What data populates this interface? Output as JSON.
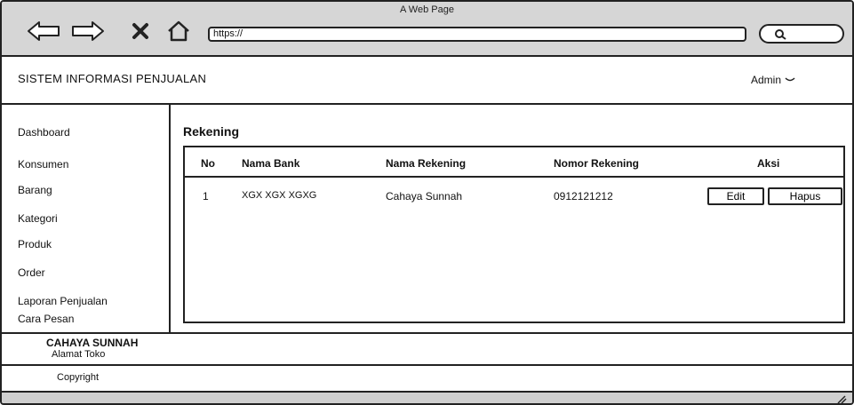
{
  "browser": {
    "window_title": "A Web Page",
    "url": "https://",
    "icons": [
      "back-arrow-icon",
      "forward-arrow-icon",
      "close-x-icon",
      "home-icon",
      "search-icon",
      "resize-grip-icon"
    ]
  },
  "header": {
    "app_title": "SISTEM INFORMASI PENJUALAN",
    "user_label": "Admin"
  },
  "sidebar": {
    "items": [
      {
        "label": "Dashboard"
      },
      {
        "label": "Konsumen"
      },
      {
        "label": "Barang"
      },
      {
        "label": "Kategori"
      },
      {
        "label": "Produk"
      },
      {
        "label": "Order"
      },
      {
        "label": "Laporan Penjualan"
      },
      {
        "label": "Cara Pesan"
      }
    ]
  },
  "main": {
    "title": "Rekening",
    "table": {
      "columns": [
        "No",
        "Nama Bank",
        "Nama Rekening",
        "Nomor Rekening",
        "Aksi"
      ],
      "rows": [
        {
          "no": "1",
          "bank": "XGX XGX XGXG",
          "nama": "Cahaya Sunnah",
          "nomor": "0912121212"
        }
      ],
      "actions": {
        "edit": "Edit",
        "delete": "Hapus"
      }
    }
  },
  "footer": {
    "brand": "CAHAYA SUNNAH",
    "address": "Alamat Toko",
    "copyright": "Copyright"
  }
}
